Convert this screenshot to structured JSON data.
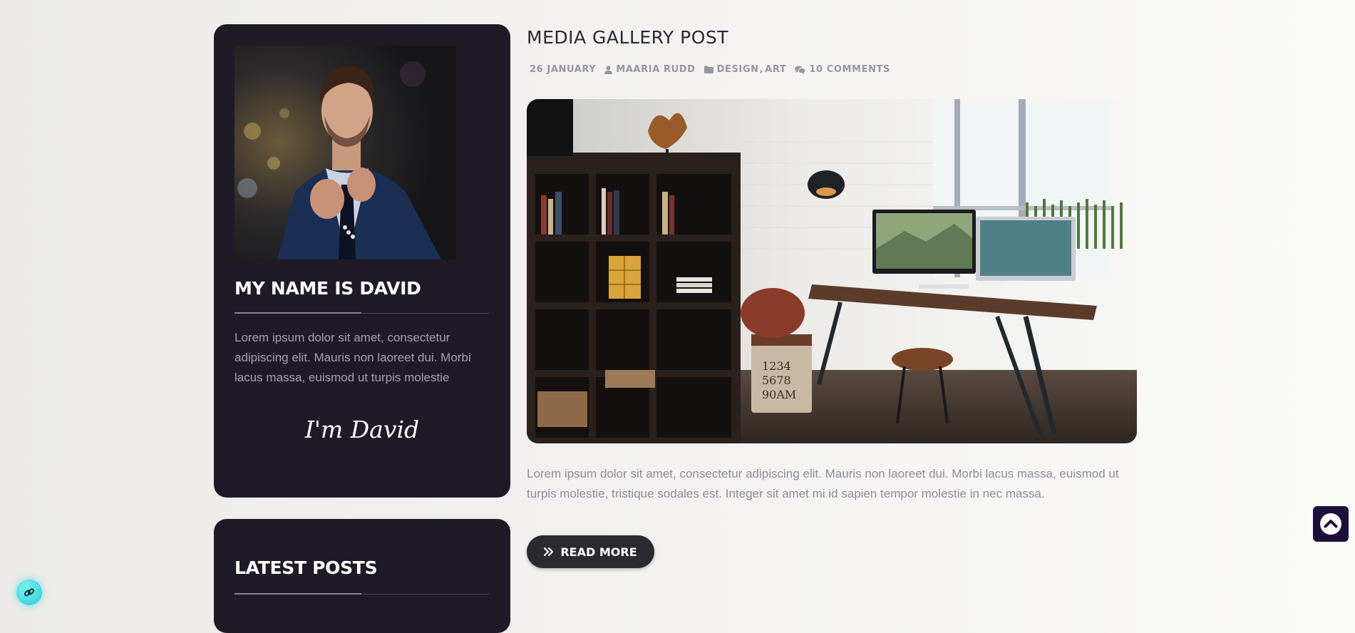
{
  "about": {
    "title": "MY NAME IS DAVID",
    "text": "Lorem ipsum dolor sit amet, consectetur adipiscing elit. Mauris non laoreet dui. Morbi lacus massa, euismod ut turpis molestie",
    "signature": "I'm David"
  },
  "latest_posts": {
    "title": "LATEST POSTS"
  },
  "post": {
    "title": "MEDIA GALLERY POST",
    "date": "26 JANUARY",
    "author": "MAARIA RUDD",
    "category_1": "DESIGN",
    "category_separator": ",",
    "category_2": "ART",
    "comments": "10 COMMENTS",
    "excerpt": "Lorem ipsum dolor sit amet, consectetur adipiscing elit. Mauris non laoreet dui. Morbi lacus massa, euismod ut turpis molestie, tristique sodales est. Integer sit amet mi id sapien tempor molestie in nec massa.",
    "read_more_label": "READ MORE"
  },
  "icons": {
    "author": "user-icon",
    "category": "folder-icon",
    "comments": "comments-icon",
    "read_more": "double-chevron-right-icon",
    "scroll_top": "chevron-up-circle-icon",
    "link": "link-icon"
  },
  "colors": {
    "card_background": "#1e1b26",
    "button_background": "#2b2a2e",
    "scroll_top_background": "#1d0f3b",
    "link_widget": "#20cdd4"
  }
}
